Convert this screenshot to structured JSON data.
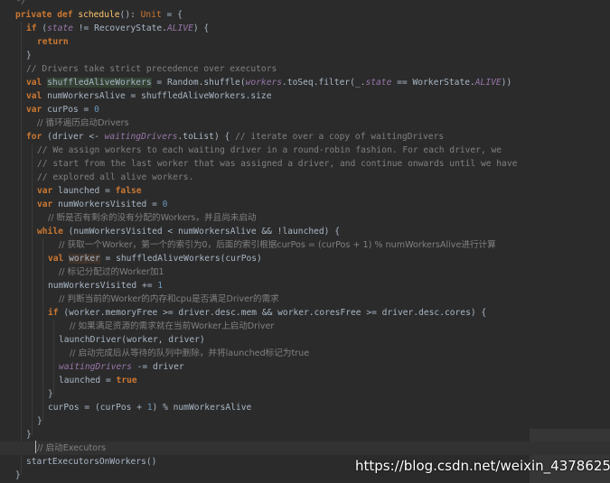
{
  "editor": {
    "top_fragment": "*/",
    "lines": [
      {
        "indent": 0,
        "tokens": [
          [
            "kw",
            "private "
          ],
          [
            "kw",
            "def "
          ],
          [
            "fn",
            "schedule"
          ],
          [
            "plain",
            "(): "
          ],
          [
            "type",
            "Unit"
          ],
          [
            "plain",
            " = {"
          ]
        ]
      },
      {
        "indent": 1,
        "tokens": [
          [
            "kw",
            "if "
          ],
          [
            "plain",
            "("
          ],
          [
            "field",
            "state"
          ],
          [
            "plain",
            " != RecoveryState."
          ],
          [
            "field",
            "ALIVE"
          ],
          [
            "plain",
            ") {"
          ]
        ]
      },
      {
        "indent": 2,
        "tokens": [
          [
            "kw",
            "return"
          ]
        ]
      },
      {
        "indent": 1,
        "tokens": [
          [
            "plain",
            "}"
          ]
        ]
      },
      {
        "indent": 1,
        "tokens": [
          [
            "cmt",
            "// Drivers take strict precedence over executors"
          ]
        ]
      },
      {
        "indent": 1,
        "tokens": [
          [
            "kw",
            "val "
          ],
          [
            "hl",
            "shuffledAliveWorkers"
          ],
          [
            "plain",
            " = Random.shuffle("
          ],
          [
            "field",
            "workers"
          ],
          [
            "plain",
            ".toSeq.filter(_."
          ],
          [
            "field",
            "state"
          ],
          [
            "plain",
            " == WorkerState."
          ],
          [
            "field",
            "ALIVE"
          ],
          [
            "plain",
            "))"
          ]
        ]
      },
      {
        "indent": 1,
        "tokens": [
          [
            "kw",
            "val "
          ],
          [
            "plain",
            "numWorkersAlive = shuffledAliveWorkers.size"
          ]
        ]
      },
      {
        "indent": 1,
        "tokens": [
          [
            "kw",
            "var "
          ],
          [
            "plain",
            "curPos = "
          ],
          [
            "num",
            "0"
          ]
        ]
      },
      {
        "indent": 2,
        "tokens": [
          [
            "cmtcn",
            "// 循环遍历启动Drivers"
          ]
        ]
      },
      {
        "indent": 1,
        "tokens": [
          [
            "kw",
            "for "
          ],
          [
            "plain",
            "(driver <- "
          ],
          [
            "field",
            "waitingDrivers"
          ],
          [
            "plain",
            ".toList) { "
          ],
          [
            "cmt",
            "// iterate over a copy of waitingDrivers"
          ]
        ]
      },
      {
        "indent": 2,
        "tokens": [
          [
            "cmt",
            "// We assign workers to each waiting driver in a round-robin fashion. For each driver, we"
          ]
        ]
      },
      {
        "indent": 2,
        "tokens": [
          [
            "cmt",
            "// start from the last worker that was assigned a driver, and continue onwards until we have"
          ]
        ]
      },
      {
        "indent": 2,
        "tokens": [
          [
            "cmt",
            "// explored all alive workers."
          ]
        ]
      },
      {
        "indent": 2,
        "tokens": [
          [
            "kw",
            "var "
          ],
          [
            "plain",
            "launched = "
          ],
          [
            "kw",
            "false"
          ]
        ]
      },
      {
        "indent": 2,
        "tokens": [
          [
            "kw",
            "var "
          ],
          [
            "plain",
            "numWorkersVisited = "
          ],
          [
            "num",
            "0"
          ]
        ]
      },
      {
        "indent": 3,
        "tokens": [
          [
            "cmtcn",
            "// 断是否有剩余的没有分配的Workers，并且尚未启动"
          ]
        ]
      },
      {
        "indent": 2,
        "tokens": [
          [
            "kw",
            "while "
          ],
          [
            "plain",
            "(numWorkersVisited < numWorkersAlive && !launched) {"
          ]
        ]
      },
      {
        "indent": 4,
        "tokens": [
          [
            "cmtcn",
            "// 获取一个Worker，第一个的索引为0，后面的索引根据curPos = (curPos + 1) % numWorkersAlive进行计算"
          ]
        ]
      },
      {
        "indent": 3,
        "tokens": [
          [
            "kw",
            "val "
          ],
          [
            "hlw",
            "worker"
          ],
          [
            "plain",
            " = shuffledAliveWorkers(curPos)"
          ]
        ]
      },
      {
        "indent": 4,
        "tokens": [
          [
            "cmtcn",
            "// 标记分配过的Worker加1"
          ]
        ]
      },
      {
        "indent": 3,
        "tokens": [
          [
            "plain",
            "numWorkersVisited += "
          ],
          [
            "num",
            "1"
          ]
        ]
      },
      {
        "indent": 4,
        "tokens": [
          [
            "cmtcn",
            "// 判断当前的Worker的内存和cpu是否满足Driver的需求"
          ]
        ]
      },
      {
        "indent": 3,
        "tokens": [
          [
            "kw",
            "if "
          ],
          [
            "plain",
            "(worker.memoryFree >= driver.desc.mem && worker.coresFree >= driver.desc.cores) {"
          ]
        ]
      },
      {
        "indent": 5,
        "tokens": [
          [
            "cmtcn",
            "// 如果满足资源的需求就在当前Worker上启动Driver"
          ]
        ]
      },
      {
        "indent": 4,
        "tokens": [
          [
            "plain",
            "launchDriver(worker, driver)"
          ]
        ]
      },
      {
        "indent": 5,
        "tokens": [
          [
            "cmtcn",
            "// 启动完成后从等待的队列中删除，并将launched标记为true"
          ]
        ]
      },
      {
        "indent": 4,
        "tokens": [
          [
            "field",
            "waitingDrivers"
          ],
          [
            "plain",
            " -= driver"
          ]
        ]
      },
      {
        "indent": 4,
        "tokens": [
          [
            "plain",
            "launched = "
          ],
          [
            "kw",
            "true"
          ]
        ]
      },
      {
        "indent": 3,
        "tokens": [
          [
            "plain",
            "}"
          ]
        ]
      },
      {
        "indent": 3,
        "tokens": [
          [
            "plain",
            "curPos = (curPos + "
          ],
          [
            "num",
            "1"
          ],
          [
            "plain",
            ") % numWorkersAlive"
          ]
        ]
      },
      {
        "indent": 2,
        "tokens": [
          [
            "plain",
            "}"
          ]
        ]
      },
      {
        "indent": 1,
        "tokens": [
          [
            "plain",
            "}"
          ]
        ]
      },
      {
        "indent": 2,
        "tokens": [
          [
            "cmtcn",
            "// 启动Executors"
          ]
        ]
      },
      {
        "indent": 1,
        "tokens": [
          [
            "plain",
            "startExecutorsOnWorkers()"
          ]
        ]
      },
      {
        "indent": 0,
        "tokens": [
          [
            "plain",
            "}"
          ]
        ]
      }
    ]
  },
  "watermark": "https://blog.csdn.net/weixin_43786255",
  "colors": {
    "background": "#2b2b2b",
    "keyword": "#cc7832",
    "function": "#ffc66d",
    "field": "#9876aa",
    "number": "#6897bb",
    "comment": "#808080",
    "text": "#a9b7c6"
  }
}
